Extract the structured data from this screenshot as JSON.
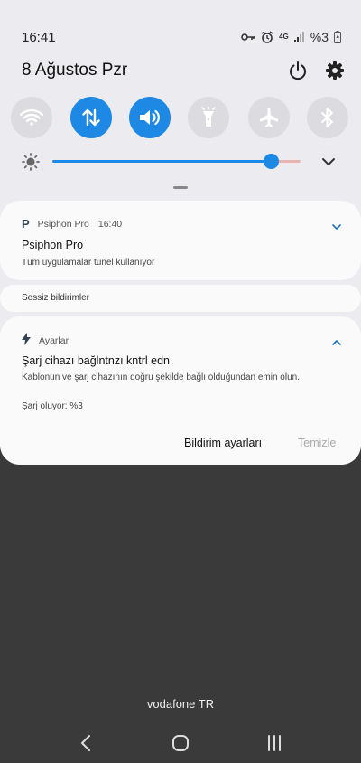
{
  "status": {
    "time": "16:41",
    "network": "4G",
    "battery_text": "%3",
    "icons": [
      "key-icon",
      "alarm-icon",
      "signal-icon",
      "battery-charging-icon"
    ]
  },
  "header": {
    "date": "8 Ağustos Pzr",
    "icons": [
      "power-icon",
      "gear-icon"
    ]
  },
  "quick_settings": [
    {
      "name": "wifi",
      "icon": "wifi-icon",
      "active": false
    },
    {
      "name": "mobile-data",
      "icon": "data-arrows-icon",
      "active": true
    },
    {
      "name": "sound",
      "icon": "volume-icon",
      "active": true
    },
    {
      "name": "flashlight",
      "icon": "flashlight-icon",
      "active": false
    },
    {
      "name": "airplane",
      "icon": "airplane-icon",
      "active": false
    },
    {
      "name": "bluetooth",
      "icon": "bluetooth-icon",
      "active": false
    }
  ],
  "brightness": {
    "level": 0.88
  },
  "notifications": {
    "psiphon": {
      "app_name": "Psiphon Pro",
      "time": "16:40",
      "title": "Psiphon Pro",
      "body": "Tüm uygulamalar tünel kullanıyor"
    },
    "silent_header": "Sessiz bildirimler",
    "settings_notif": {
      "app_name": "Ayarlar",
      "title": "Şarj cihazı bağlntnzı kntrl edn",
      "body": "Kablonun ve şarj cihazının doğru şekilde bağlı olduğundan emin olun.",
      "status": "Şarj oluyor: %3"
    }
  },
  "actions": {
    "notification_settings": "Bildirim ayarları",
    "clear": "Temizle"
  },
  "carrier": "vodafone TR",
  "colors": {
    "accent": "#1e88e5",
    "panel": "#ececf0",
    "card": "#fafafa",
    "background": "#3a3a3a"
  }
}
